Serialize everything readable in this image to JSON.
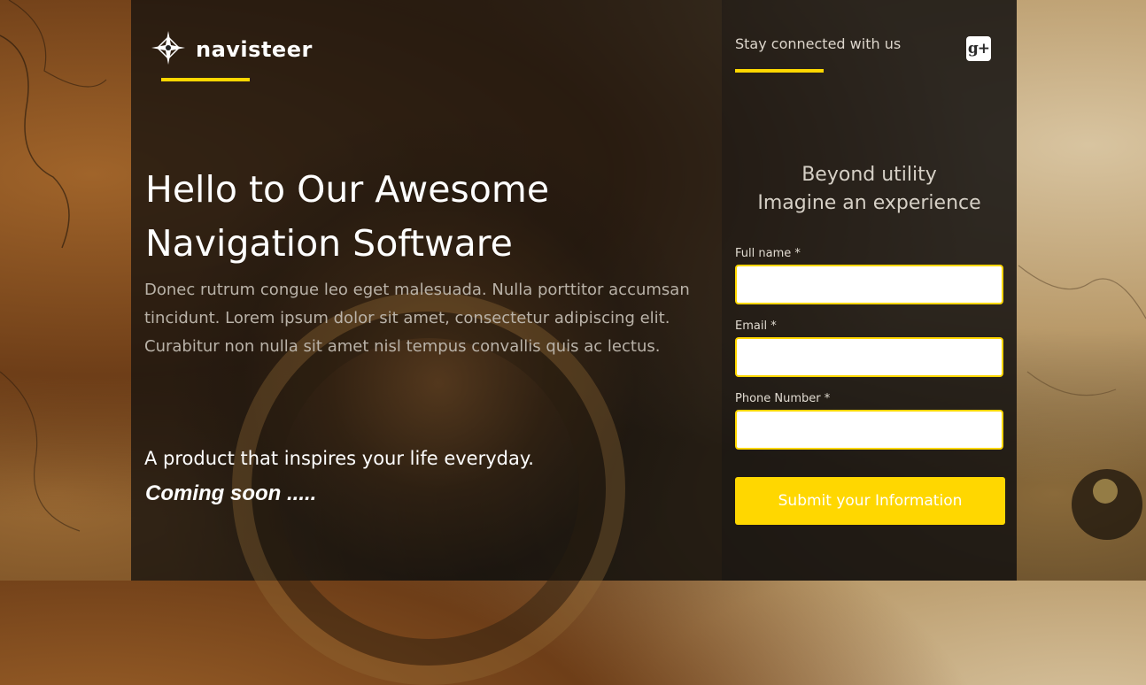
{
  "brand": {
    "name": "navisteer",
    "logo_icon": "compass-star-icon",
    "accent_color": "#ffd700"
  },
  "hero": {
    "title_line1": "Hello to Our Awesome",
    "title_line2": "Navigation Software",
    "description": "Donec rutrum congue leo eget malesuada. Nulla porttitor accumsan tincidunt. Lorem ipsum dolor sit amet, consectetur adipiscing elit. Curabitur non nulla sit amet nisl tempus convallis quis ac lectus.",
    "tagline": "A product that inspires your life everyday.",
    "coming_soon": "Coming soon ....."
  },
  "sidebar": {
    "stay_connected": "Stay connected with us",
    "social_icon": "google-plus-icon",
    "social_label": "g+",
    "headline_line1": "Beyond utility",
    "headline_line2": "Imagine an experience"
  },
  "form": {
    "full_name_label": "Full name *",
    "full_name_value": "",
    "email_label": "Email *",
    "email_value": "",
    "phone_label": "Phone Number *",
    "phone_value": "",
    "submit_label": "Submit your Information"
  }
}
